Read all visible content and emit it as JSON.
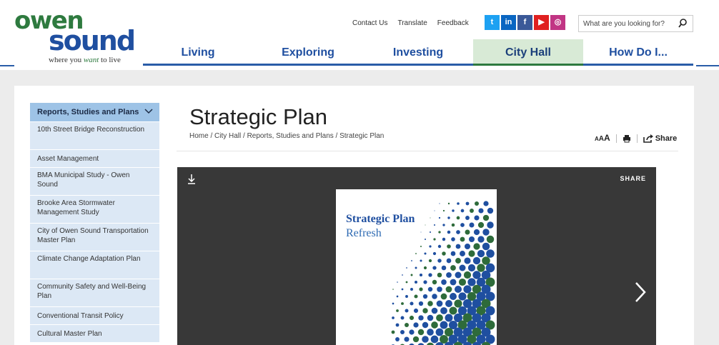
{
  "logo": {
    "line1": "owen",
    "line2": "sound",
    "tagline_pre": "where you ",
    "tagline_em": "want",
    "tagline_post": " to live"
  },
  "utility": [
    "Contact Us",
    "Translate",
    "Feedback"
  ],
  "social": [
    {
      "name": "twitter",
      "glyph": "t",
      "color": "#1da1f2"
    },
    {
      "name": "linkedin",
      "glyph": "in",
      "color": "#0a66c2"
    },
    {
      "name": "facebook",
      "glyph": "f",
      "color": "#3b5998"
    },
    {
      "name": "youtube",
      "glyph": "▶",
      "color": "#e02020"
    },
    {
      "name": "instagram",
      "glyph": "◎",
      "color": "#c13584"
    }
  ],
  "search": {
    "placeholder": "What are you looking for?"
  },
  "nav": [
    {
      "label": "Living",
      "active": false
    },
    {
      "label": "Exploring",
      "active": false
    },
    {
      "label": "Investing",
      "active": false
    },
    {
      "label": "City Hall",
      "active": true
    },
    {
      "label": "How Do I...",
      "active": false
    }
  ],
  "sidebar": {
    "heading": "Reports, Studies and Plans",
    "items": [
      "10th Street Bridge Reconstruction",
      "Asset Management",
      "BMA Municipal Study - Owen Sound",
      "Brooke Area Stormwater Management Study",
      "City of Owen Sound Transportation Master Plan",
      "Climate Change Adaptation Plan",
      "Community Safety and Well-Being Plan",
      "Conventional Transit Policy",
      "Cultural Master Plan"
    ]
  },
  "page": {
    "title": "Strategic Plan",
    "breadcrumb": "Home / City Hall / Reports, Studies and Plans / Strategic Plan"
  },
  "tools": {
    "text_size_small": "A",
    "text_size_mid": "A",
    "text_size_large": "A",
    "share_label": "Share"
  },
  "viewer": {
    "share_label": "SHARE",
    "doc_title_1": "Strategic Plan",
    "doc_title_2": "Refresh"
  },
  "colors": {
    "brand_blue": "#1f4fa0",
    "brand_green": "#2e7a3f",
    "sidebar_head": "#9ec3e6",
    "sidebar_item": "#dce8f5"
  }
}
